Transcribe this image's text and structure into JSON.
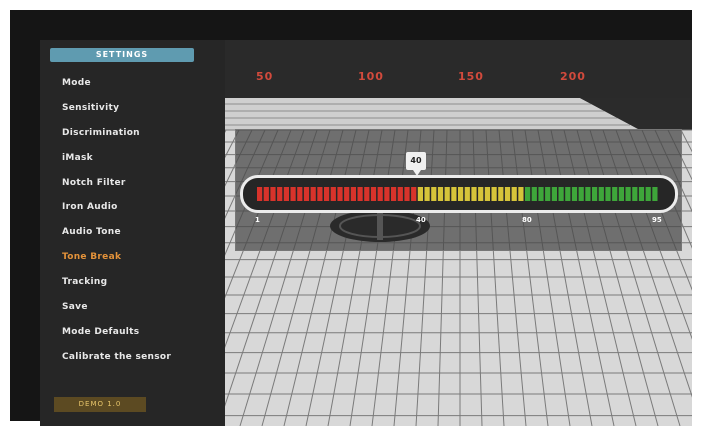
{
  "sidebar": {
    "tab_label": "SETTINGS",
    "items": [
      {
        "label": "Mode"
      },
      {
        "label": "Sensitivity"
      },
      {
        "label": "Discrimination"
      },
      {
        "label": "iMask"
      },
      {
        "label": "Notch Filter"
      },
      {
        "label": "Iron Audio"
      },
      {
        "label": "Audio Tone"
      },
      {
        "label": "Tone Break"
      },
      {
        "label": "Tracking"
      },
      {
        "label": "Save"
      },
      {
        "label": "Mode Defaults"
      },
      {
        "label": "Calibrate the sensor"
      }
    ],
    "active_item": "Tone Break",
    "version_label": "DEMO 1.0"
  },
  "scale": {
    "labels": [
      "50",
      "100",
      "150",
      "200"
    ]
  },
  "meter": {
    "current_value": "40",
    "tick_labels": [
      "1",
      "40",
      "80",
      "95"
    ],
    "colors": {
      "low": "#d8332b",
      "mid": "#d6c43a",
      "high": "#3ea63a"
    },
    "split_fraction_1": 0.4,
    "split_fraction_2": 0.66
  },
  "colors": {
    "accent": "#e3923a",
    "tab": "#5f9bb0",
    "scale": "#d24a3c"
  },
  "icons": {
    "coil": "search-coil-icon"
  }
}
